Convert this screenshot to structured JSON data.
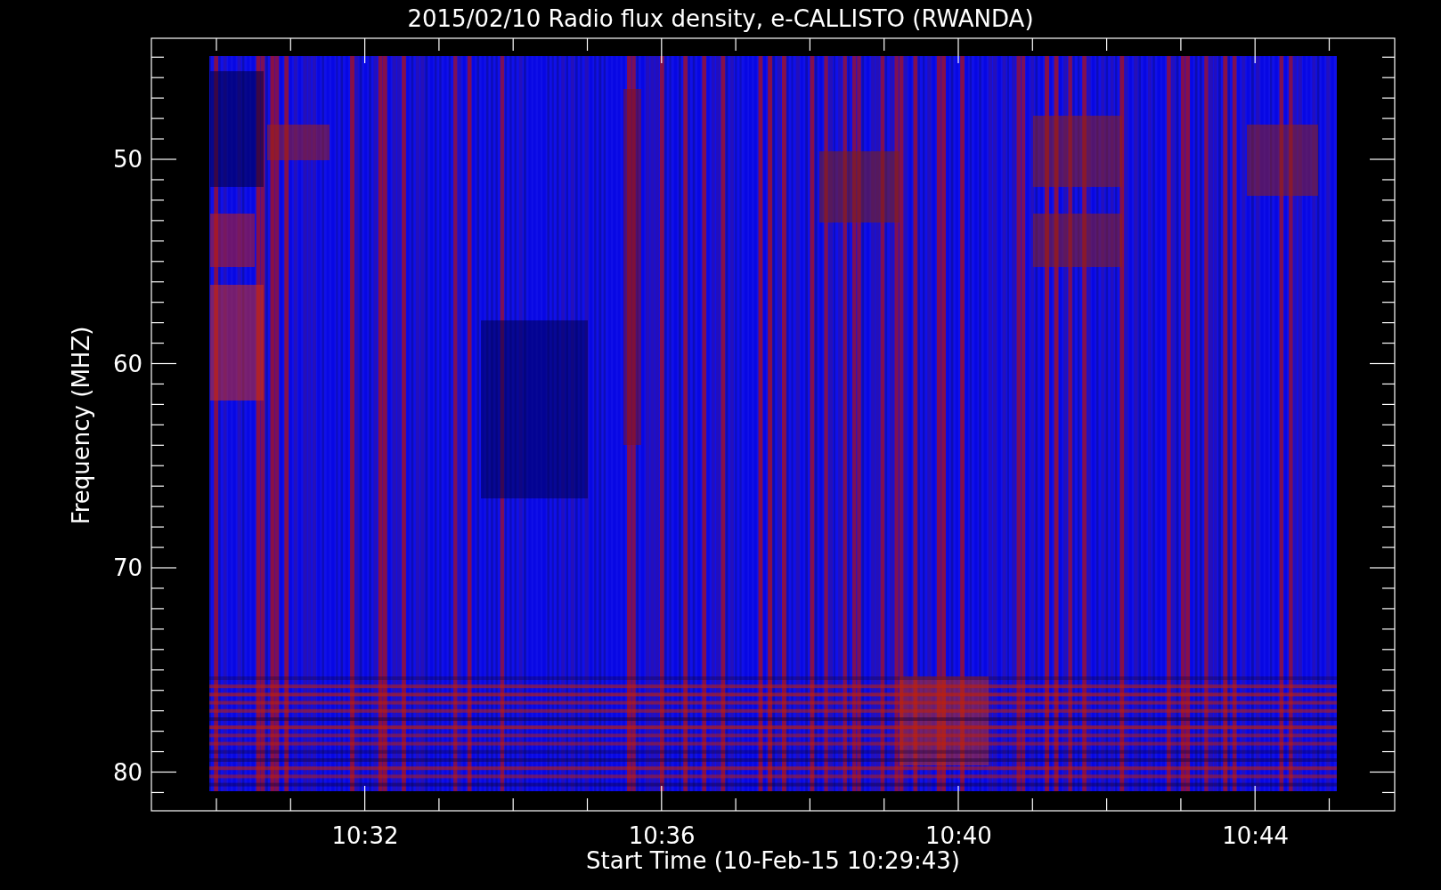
{
  "title": "2015/02/10  Radio flux density, e-CALLISTO (RWANDA)",
  "y_axis": {
    "label": "Frequency (MHZ)",
    "ticks": [
      "50",
      "60",
      "70",
      "80"
    ]
  },
  "x_axis": {
    "label": "Start Time (10-Feb-15 10:29:43)",
    "ticks": [
      "10:32",
      "10:36",
      "10:40",
      "10:44"
    ]
  }
}
